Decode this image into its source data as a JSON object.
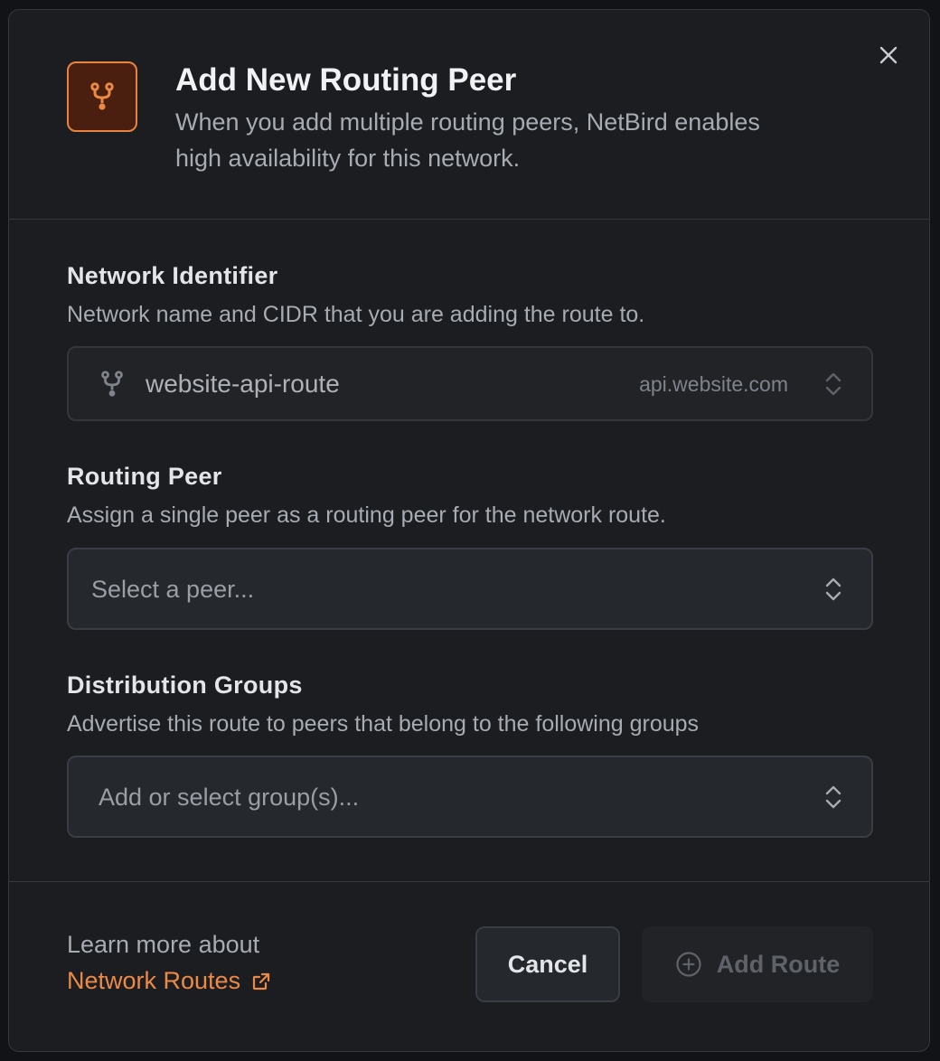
{
  "dialog": {
    "title": "Add New Routing Peer",
    "subtitle": "When you add multiple routing peers, NetBird enables high availability for this network.",
    "header_icon": "route-icon",
    "close_icon": "close-icon"
  },
  "network_identifier": {
    "label": "Network Identifier",
    "help": "Network name and CIDR that you are adding the route to.",
    "value": "website-api-route",
    "domain": "api.website.com",
    "icon": "route-icon",
    "disabled": true
  },
  "routing_peer": {
    "label": "Routing Peer",
    "help": "Assign a single peer as a routing peer for the network route.",
    "placeholder": "Select a peer..."
  },
  "distribution_groups": {
    "label": "Distribution Groups",
    "help": "Advertise this route to peers that belong to the following groups",
    "placeholder": "Add or select group(s)..."
  },
  "footer": {
    "learn_text": "Learn more about",
    "learn_link": "Network Routes",
    "link_icon": "external-link-icon",
    "cancel_label": "Cancel",
    "add_label": "Add Route",
    "add_icon": "plus-circle-icon",
    "add_disabled": true
  },
  "colors": {
    "accent": "#ec8a45",
    "background": "#1b1d21",
    "field_background": "#25282c"
  }
}
